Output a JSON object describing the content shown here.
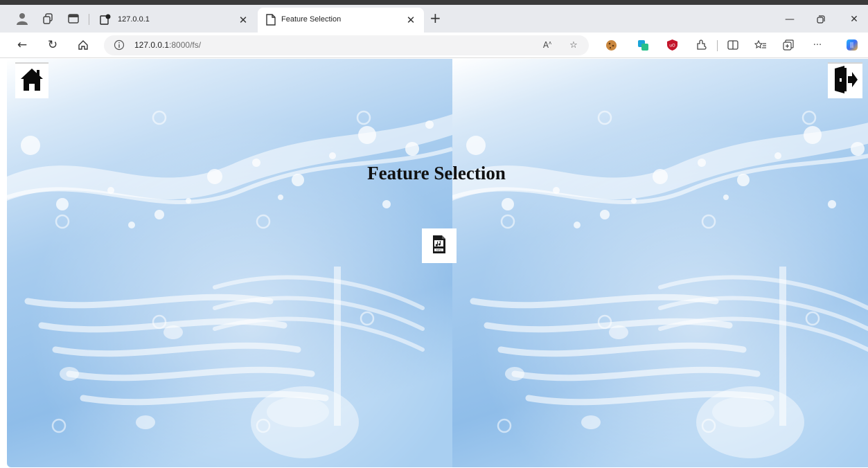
{
  "browser": {
    "tabs": [
      {
        "title": "127.0.0.1",
        "active": false
      },
      {
        "title": "Feature Selection",
        "active": true
      }
    ],
    "url": {
      "host": "127.0.0.1",
      "path": ":8000/fs/"
    },
    "colors": {
      "tab_strip": "#e8eaee",
      "address_bar": "#f3f3f4",
      "top_edge": "#3b3b3b"
    }
  },
  "page": {
    "heading": "Feature Selection",
    "buttons": {
      "home_icon": "home-icon",
      "logout_icon": "logout-icon",
      "audio_icon": "audio-file-icon"
    },
    "colors": {
      "background_sky": "#b8d6f2",
      "background_light": "#e9f3fc",
      "heading": "#111111"
    }
  }
}
